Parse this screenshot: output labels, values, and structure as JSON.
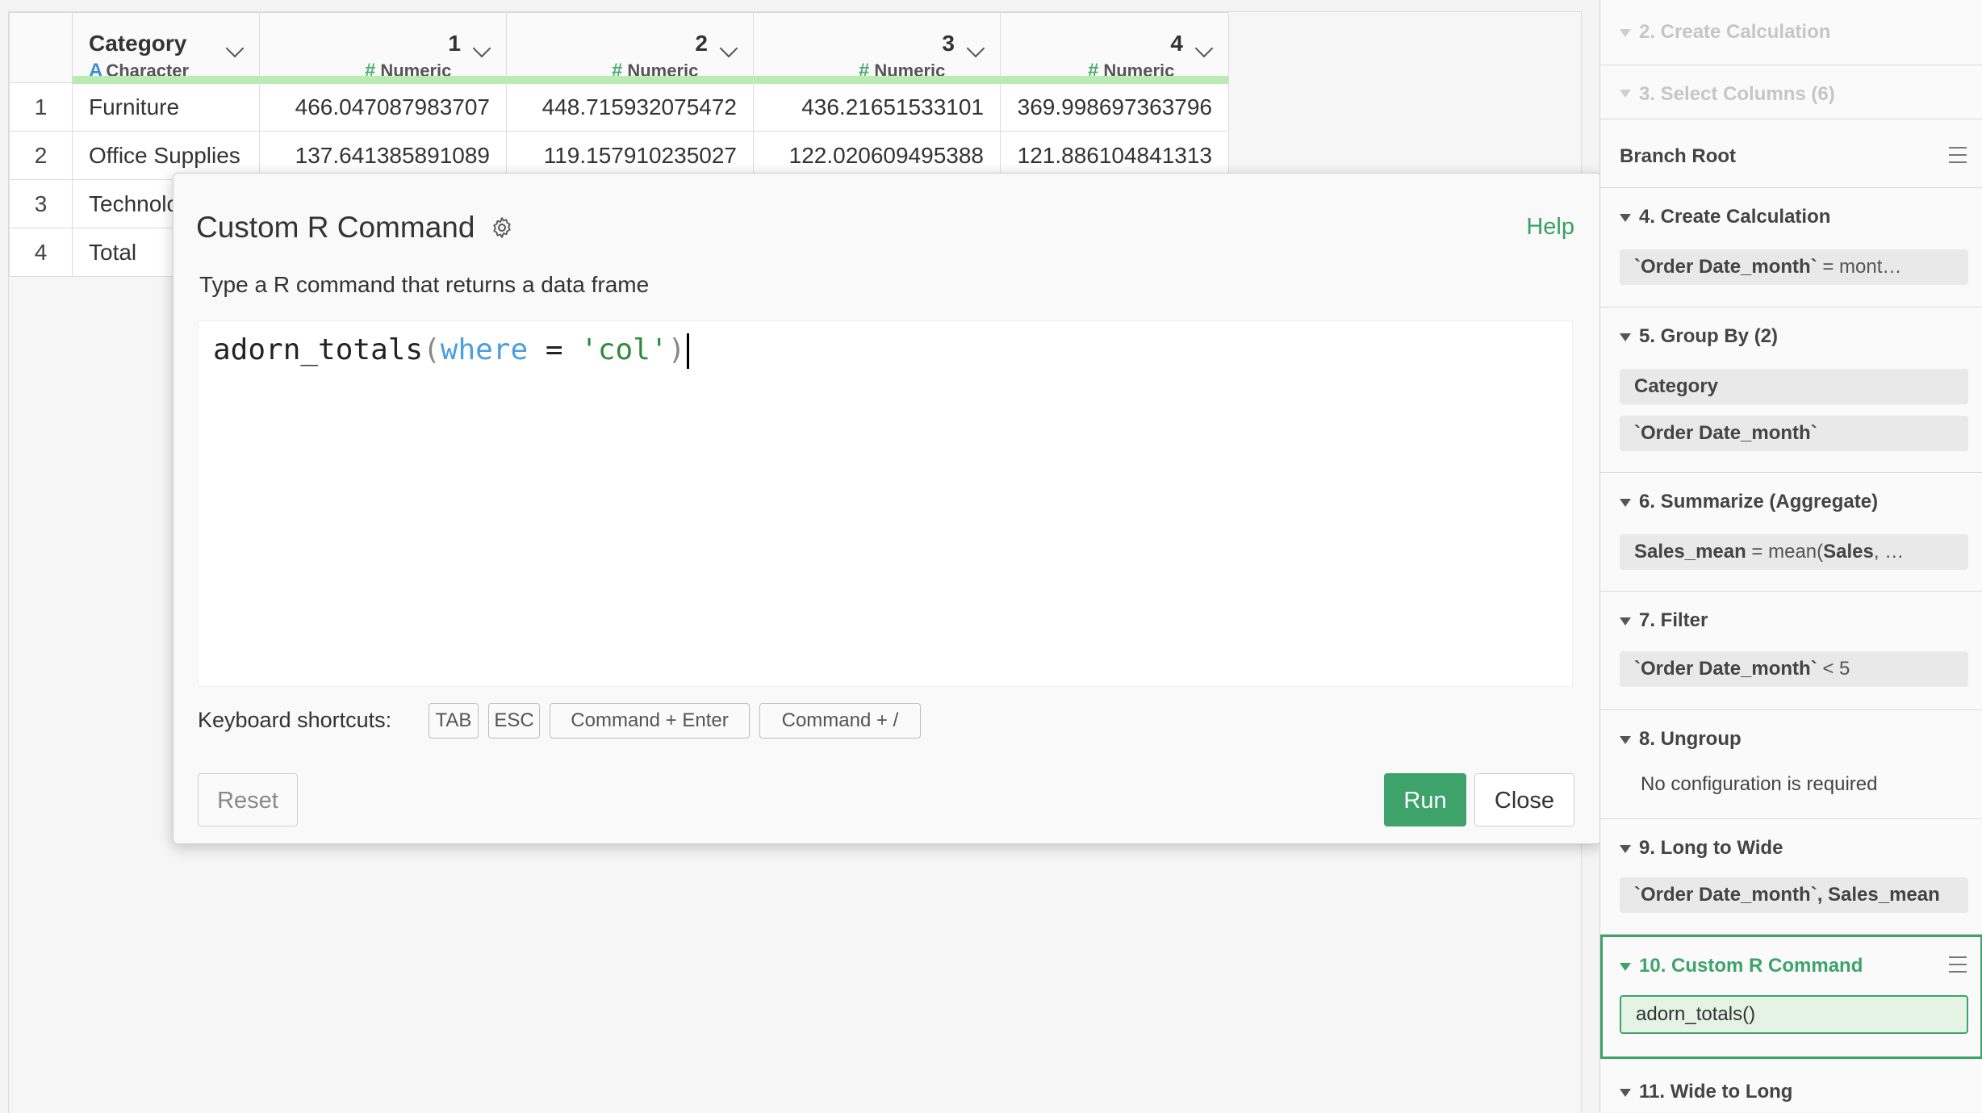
{
  "grid": {
    "columns": [
      {
        "name": "Category",
        "type_glyph": "A",
        "type": "Character"
      },
      {
        "name": "1",
        "type_glyph": "#",
        "type": "Numeric"
      },
      {
        "name": "2",
        "type_glyph": "#",
        "type": "Numeric"
      },
      {
        "name": "3",
        "type_glyph": "#",
        "type": "Numeric"
      },
      {
        "name": "4",
        "type_glyph": "#",
        "type": "Numeric"
      }
    ],
    "rows": [
      {
        "num": "1",
        "cells": [
          "Furniture",
          "466.047087983707",
          "448.715932075472",
          "436.21651533101",
          "369.998697363796"
        ]
      },
      {
        "num": "2",
        "cells": [
          "Office Supplies",
          "137.641385891089",
          "119.157910235027",
          "122.020609495388",
          "121.886104841313"
        ]
      },
      {
        "num": "3",
        "cells": [
          "Technolo",
          "",
          "",
          "",
          ""
        ]
      },
      {
        "num": "4",
        "cells": [
          "Total",
          "",
          "",
          "",
          ""
        ]
      }
    ]
  },
  "dialog": {
    "title": "Custom R Command",
    "help": "Help",
    "description": "Type a R command that returns a data frame",
    "code": {
      "fn": "adorn_totals",
      "open": "(",
      "kw": "where",
      "op": " = ",
      "str": "'col'",
      "close": ")"
    },
    "shortcuts_label": "Keyboard shortcuts:",
    "shortcuts": [
      "TAB",
      "ESC",
      "Command + Enter",
      "Command + /"
    ],
    "reset": "Reset",
    "run": "Run",
    "close": "Close"
  },
  "panel": {
    "steps": [
      {
        "title": "2. Create Calculation"
      },
      {
        "title": "3. Select Columns (6)"
      },
      {
        "title": "Branch Root"
      },
      {
        "title": "4. Create Calculation",
        "pill_code": "`Order Date_month`",
        "pill_rest": " = mont…"
      },
      {
        "title": "5. Group By (2)",
        "pills": [
          "Category",
          "`Order Date_month`"
        ]
      },
      {
        "title": "6. Summarize (Aggregate)",
        "pill_code": "Sales_mean",
        "pill_mid": " = mean(",
        "pill_code2": "Sales",
        "pill_rest": ", …"
      },
      {
        "title": "7. Filter",
        "pill_code": "`Order Date_month`",
        "pill_rest": " < 5"
      },
      {
        "title": "8. Ungroup",
        "note": "No configuration is required"
      },
      {
        "title": "9. Long to Wide",
        "pill_code": "`Order Date_month`, Sales_mean"
      },
      {
        "title": "10. Custom R Command",
        "pill": "adorn_totals()"
      },
      {
        "title": "11. Wide to Long"
      }
    ]
  },
  "colors": {
    "accent_green": "#3ea36a",
    "type_numeric": "#4caf6e",
    "type_character": "#3a8fd3",
    "header_bar": "#b9ebb3"
  }
}
